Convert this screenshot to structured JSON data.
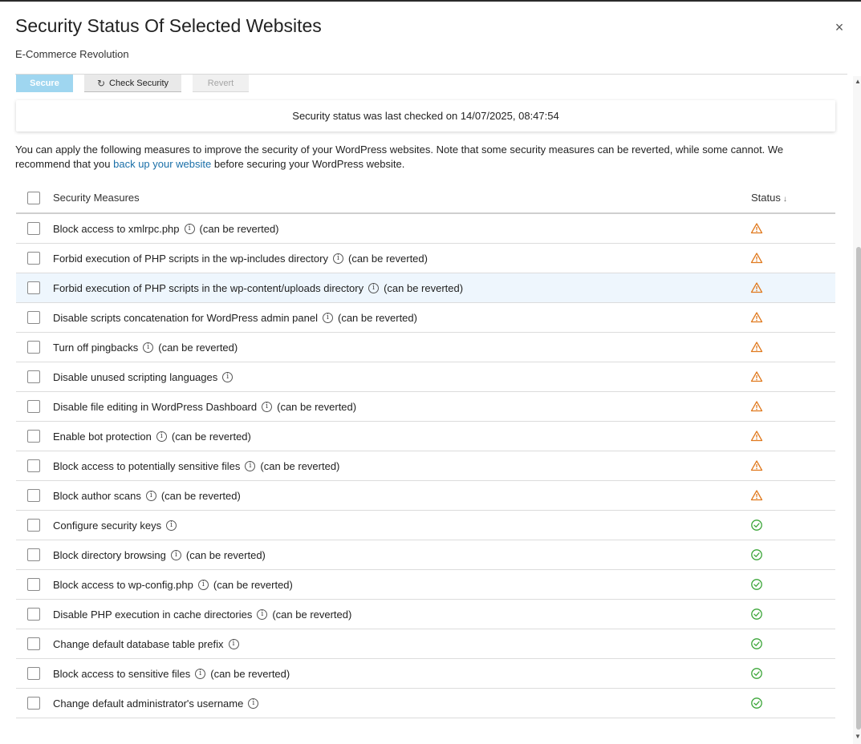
{
  "dialog": {
    "title": "Security Status Of Selected Websites",
    "subtitle": "E-Commerce Revolution",
    "close_glyph": "×"
  },
  "toolbar": {
    "secure_label": "Secure",
    "check_label": "Check Security",
    "check_icon": "refresh-icon",
    "revert_label": "Revert"
  },
  "status_message": "Security status was last checked on 14/07/2025, 08:47:54",
  "intro": {
    "part1": "You can apply the following measures to improve the security of your WordPress websites. Note that some security measures can be reverted, while some cannot. We recommend that you ",
    "link": "back up your website",
    "part2": " before securing your WordPress website."
  },
  "table": {
    "header_measures": "Security Measures",
    "header_status": "Status",
    "sort_arrow": "↓",
    "revert_note": "(can be reverted)",
    "info_glyph": "i",
    "status_colors": {
      "warning": "#e07a1f",
      "ok": "#3aa537"
    },
    "rows": [
      {
        "label": "Block access to xmlrpc.php",
        "revertible": "(can be reverted)",
        "status": "warning"
      },
      {
        "label": "Forbid execution of PHP scripts in the wp-includes directory",
        "revertible": "(can be reverted)",
        "status": "warning"
      },
      {
        "label": "Forbid execution of PHP scripts in the wp-content/uploads directory",
        "revertible": "(can be reverted)",
        "status": "warning"
      },
      {
        "label": "Disable scripts concatenation for WordPress admin panel",
        "revertible": "(can be reverted)",
        "status": "warning"
      },
      {
        "label": "Turn off pingbacks",
        "revertible": "(can be reverted)",
        "status": "warning"
      },
      {
        "label": "Disable unused scripting languages",
        "revertible": "",
        "status": "warning"
      },
      {
        "label": "Disable file editing in WordPress Dashboard",
        "revertible": "(can be reverted)",
        "status": "warning"
      },
      {
        "label": "Enable bot protection",
        "revertible": "(can be reverted)",
        "status": "warning"
      },
      {
        "label": "Block access to potentially sensitive files",
        "revertible": "(can be reverted)",
        "status": "warning"
      },
      {
        "label": "Block author scans",
        "revertible": "(can be reverted)",
        "status": "warning"
      },
      {
        "label": "Configure security keys",
        "revertible": "",
        "status": "ok"
      },
      {
        "label": "Block directory browsing",
        "revertible": "(can be reverted)",
        "status": "ok"
      },
      {
        "label": "Block access to wp-config.php",
        "revertible": "(can be reverted)",
        "status": "ok"
      },
      {
        "label": "Disable PHP execution in cache directories",
        "revertible": "(can be reverted)",
        "status": "ok"
      },
      {
        "label": "Change default database table prefix",
        "revertible": "",
        "status": "ok"
      },
      {
        "label": "Block access to sensitive files",
        "revertible": "(can be reverted)",
        "status": "ok"
      },
      {
        "label": "Change default administrator's username",
        "revertible": "",
        "status": "ok"
      }
    ]
  },
  "scrollbar": {
    "up_glyph": "▲",
    "down_glyph": "▼"
  }
}
